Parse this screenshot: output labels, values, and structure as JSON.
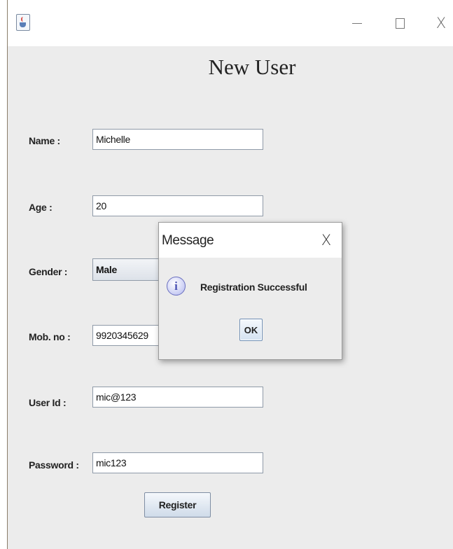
{
  "window": {
    "app_icon": "java-cup-icon",
    "controls": {
      "minimize": "minimize-icon",
      "maximize": "maximize-icon",
      "close_label": "X"
    }
  },
  "form": {
    "title": "New User",
    "fields": {
      "name": {
        "label": "Name :",
        "value": "Michelle"
      },
      "age": {
        "label": "Age :",
        "value": "20"
      },
      "gender": {
        "label": "Gender :",
        "value": "Male"
      },
      "mobile": {
        "label": "Mob. no :",
        "value": "9920345629"
      },
      "user_id": {
        "label": "User Id :",
        "value": "mic@123"
      },
      "password": {
        "label": "Password :",
        "value": "mic123"
      }
    },
    "register_label": "Register"
  },
  "dialog": {
    "title": "Message",
    "close_label": "X",
    "icon": "info-icon",
    "icon_glyph": "i",
    "message": "Registration Successful",
    "ok_label": "OK"
  },
  "colors": {
    "window_bg": "#ececec",
    "titlebar_bg": "#ffffff",
    "button_gradient_top": "#f5f8fc",
    "button_gradient_bottom": "#cfdbe9"
  }
}
